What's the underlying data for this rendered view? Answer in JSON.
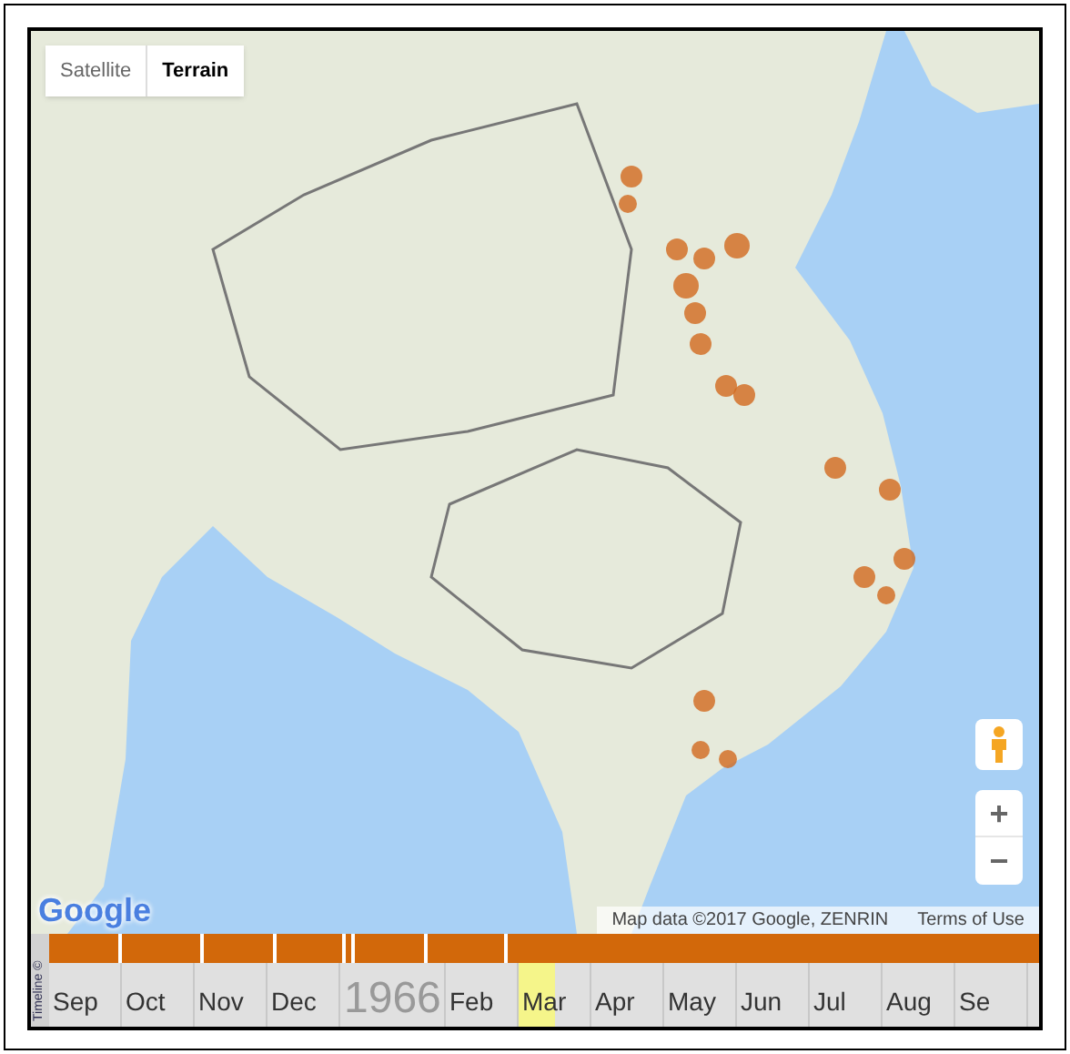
{
  "map_type_tabs": [
    {
      "label": "Satellite",
      "selected": false
    },
    {
      "label": "Terrain",
      "selected": true
    }
  ],
  "zoom_controls": [
    {
      "kind": "in",
      "label": "+"
    },
    {
      "kind": "out",
      "label": "−"
    }
  ],
  "attribution": {
    "logo": "Google",
    "map_data": "Map data ©2017 Google, ZENRIN",
    "terms": "Terms of Use"
  },
  "timeline": {
    "label": "Timeline ©",
    "cells": [
      {
        "kind": "month",
        "label": "Sep",
        "selected": false
      },
      {
        "kind": "month",
        "label": "Oct",
        "selected": false
      },
      {
        "kind": "month",
        "label": "Nov",
        "selected": false
      },
      {
        "kind": "month",
        "label": "Dec",
        "selected": false
      },
      {
        "kind": "year",
        "label": "1966",
        "selected": false
      },
      {
        "kind": "month",
        "label": "Feb",
        "selected": false
      },
      {
        "kind": "month",
        "label": "Mar",
        "selected": true
      },
      {
        "kind": "month",
        "label": "Apr",
        "selected": false
      },
      {
        "kind": "month",
        "label": "May",
        "selected": false
      },
      {
        "kind": "month",
        "label": "Jun",
        "selected": false
      },
      {
        "kind": "month",
        "label": "Jul",
        "selected": false
      },
      {
        "kind": "month",
        "label": "Aug",
        "selected": false
      },
      {
        "kind": "month",
        "label": "Se",
        "selected": false
      }
    ]
  }
}
